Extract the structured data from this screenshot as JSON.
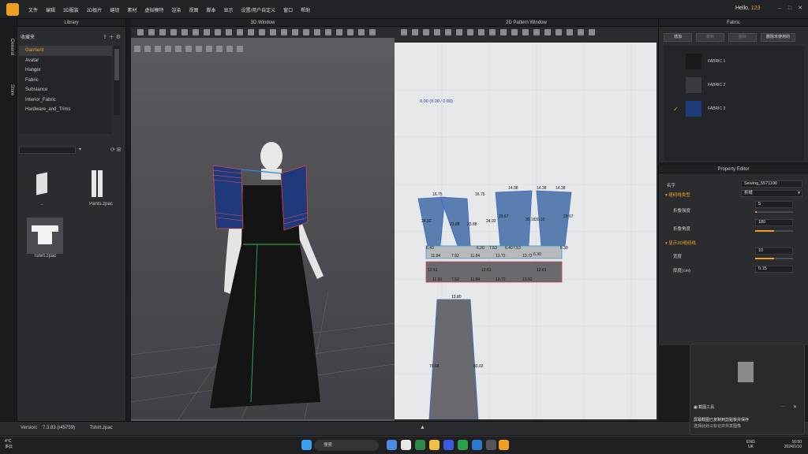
{
  "menubar": {
    "items": [
      "文件",
      "编辑",
      "3D服装",
      "2D板片",
      "缝纫",
      "素材",
      "虚拟模特",
      "渲染",
      "视图",
      "脚本",
      "显示",
      "设置/用户自定义",
      "窗口",
      "帮助"
    ],
    "greeting": "Hello, ",
    "username": "123"
  },
  "sidetabs": [
    "General",
    "Store"
  ],
  "library": {
    "title": "Library",
    "favorites": "收藏夹",
    "tree": [
      "Garment",
      "Avatar",
      "Hanger",
      "Fabric",
      "Substance",
      "Interior_Fabric",
      "Hardware_and_Trims"
    ],
    "files": [
      {
        "label": ".."
      },
      {
        "label": "Pants.zpac"
      },
      {
        "label": "Tshirt.zpac"
      }
    ]
  },
  "view3d": {
    "title": "3D Window"
  },
  "view2d": {
    "title": "2D Pattern Window",
    "coord": "0.00 (0.00 / 0.00)",
    "measurements": [
      "16.75",
      "16.75",
      "14.38",
      "14.38",
      "24.92",
      "23.88",
      "23.88",
      "24.92",
      "29.67",
      "30.18",
      "30.10",
      "29.67",
      "6.40",
      "6.20",
      "6.40",
      "6.30",
      "6.30",
      "11.84",
      "7.92",
      "11.84",
      "13.72",
      "13.72",
      "12.61",
      "12.61",
      "12.61",
      "11.60",
      "7.92",
      "11.84",
      "13.72",
      "13.52",
      "13.80",
      "79.68",
      "80.02",
      "7.53",
      "7.53",
      "14.38"
    ]
  },
  "fabric": {
    "title": "Fabric",
    "buttons": [
      {
        "label": "增加",
        "dim": false
      },
      {
        "label": "复制",
        "dim": true
      },
      {
        "label": "删除",
        "dim": true
      },
      {
        "label": "删除未使用的",
        "dim": false
      }
    ],
    "items": [
      {
        "name": "FABRIC 1",
        "color": "#1a1a1c",
        "checked": false
      },
      {
        "name": "FABRIC 2",
        "color": "#3a3b40",
        "checked": false
      },
      {
        "name": "FABRIC 3",
        "color": "#1f3a78",
        "checked": true
      }
    ]
  },
  "property": {
    "title": "Property Editor",
    "name_label": "名字",
    "name_value": "Sewing_5571100",
    "section1": "缝纫线类型",
    "section1_value": "折缝",
    "fold_strength_label": "折叠强度",
    "fold_strength": "5",
    "fold_angle_label": "折叠角度",
    "fold_angle": "180",
    "section2": "显示3D缝纫线",
    "width_label": "宽度",
    "width": "10",
    "thickness_label": "厚度(cm)",
    "thickness": "0.15"
  },
  "status": {
    "version_label": "Version:",
    "version": "7.3.83 (r45759)",
    "file": "Tshirt.zpac"
  },
  "notification": {
    "app": "截图工具",
    "line1": "屏幕截图已复制到剪贴板并保存",
    "line2": "选择此处以标记并共享图像"
  },
  "taskbar": {
    "weather": "4°C",
    "weather2": "多云",
    "search": "搜索",
    "lang": "ENG",
    "region": "UK",
    "time": "16:50",
    "date": "2024/1/10"
  }
}
